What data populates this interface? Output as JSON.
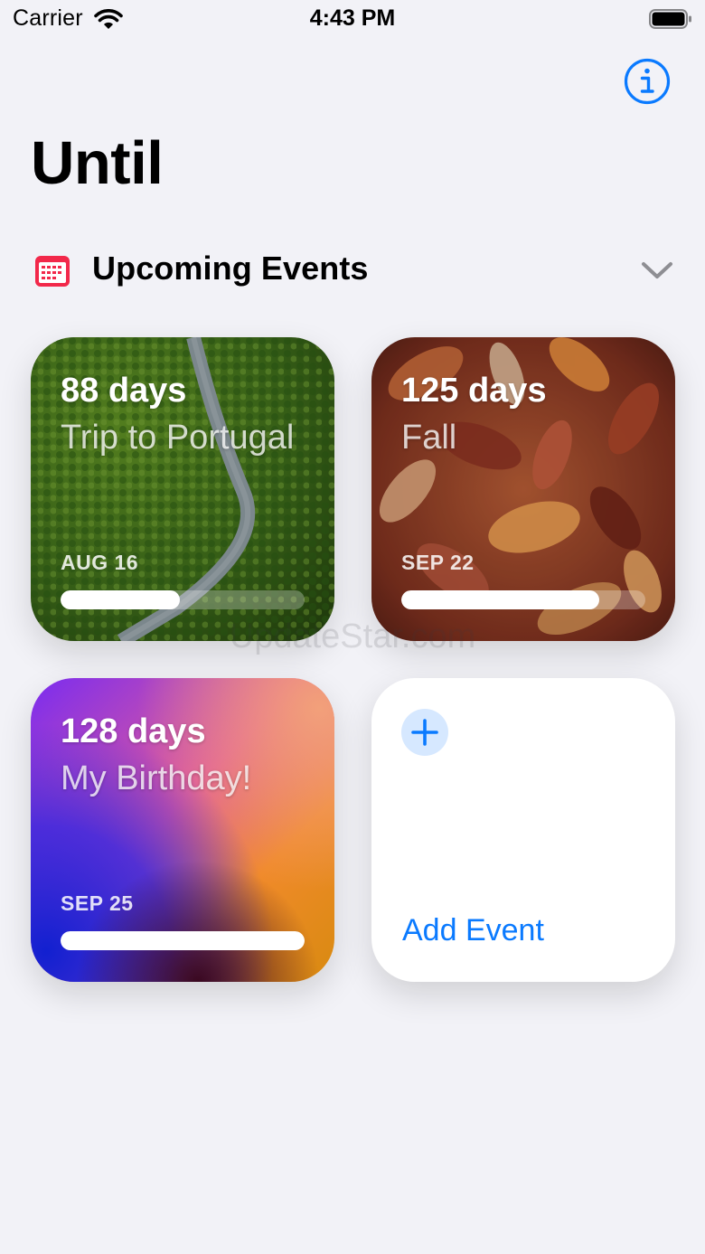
{
  "status_bar": {
    "carrier": "Carrier",
    "time": "4:43 PM",
    "icons": [
      "wifi-icon",
      "battery-icon"
    ]
  },
  "header": {
    "info_icon": "info-circle-icon",
    "title": "Until"
  },
  "section": {
    "icon": "calendar-icon",
    "title": "Upcoming Events",
    "chevron": "chevron-down-icon"
  },
  "events": [
    {
      "days": "88 days",
      "name": "Trip to Portugal",
      "date": "AUG 16",
      "progress": 0.49,
      "background": "aerial-forest-road-photo"
    },
    {
      "days": "125 days",
      "name": "Fall",
      "date": "SEP 22",
      "progress": 0.81,
      "background": "autumn-leaves-photo"
    },
    {
      "days": "128 days",
      "name": "My Birthday!",
      "date": "SEP 25",
      "progress": 1.0,
      "background": "gradient"
    }
  ],
  "add_event": {
    "icon": "plus-icon",
    "label": "Add Event"
  },
  "watermark": "UpdateStar.com",
  "colors": {
    "accent": "#0a7aff",
    "calendar_red": "#f2284a",
    "background": "#f2f2f7",
    "card_white": "#ffffff"
  }
}
